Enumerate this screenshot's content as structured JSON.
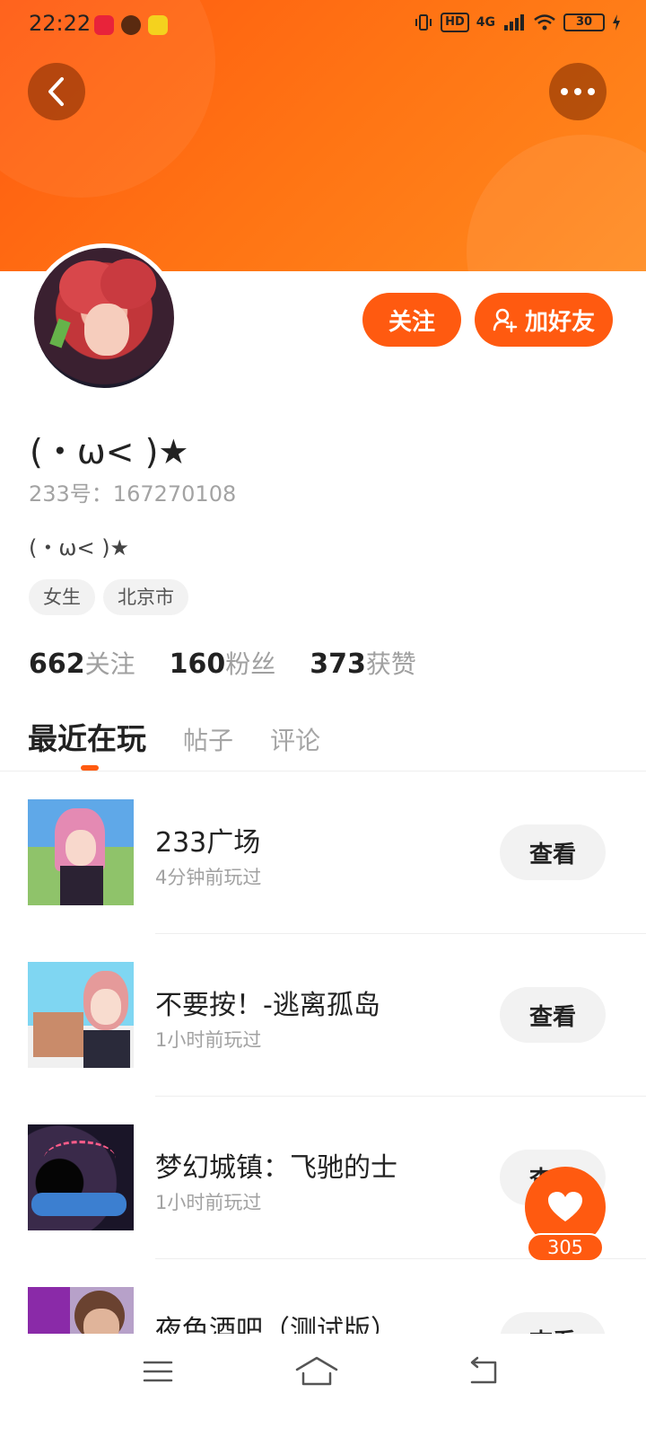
{
  "status_bar": {
    "time": "22:22",
    "hd_label": "HD",
    "network_label": "4G",
    "battery_level": "30"
  },
  "header": {
    "back_icon": "chevron-left-icon",
    "more_icon": "more-dots-icon",
    "accent_color": "#ff5a10"
  },
  "profile": {
    "nickname": "(・ω< )★",
    "user_id": "233号：167270108",
    "bio": "(・ω< )★",
    "tags": [
      "女生",
      "北京市"
    ],
    "follow_button": "关注",
    "add_friend_button": "加好友",
    "stats": [
      {
        "value": "662",
        "label": "关注"
      },
      {
        "value": "160",
        "label": "粉丝"
      },
      {
        "value": "373",
        "label": "获赞"
      }
    ]
  },
  "tabs": [
    {
      "label": "最近在玩",
      "active": true
    },
    {
      "label": "帖子",
      "active": false
    },
    {
      "label": "评论",
      "active": false
    }
  ],
  "games": [
    {
      "name": "233广场",
      "played": "4分钟前玩过",
      "button": "查看"
    },
    {
      "name": "不要按！-逃离孤岛",
      "played": "1小时前玩过",
      "button": "查看"
    },
    {
      "name": "梦幻城镇：飞驰的士",
      "played": "1小时前玩过",
      "button": "查看"
    },
    {
      "name": "夜色酒吧（测试版）",
      "played": "",
      "button": "查看"
    }
  ],
  "like_fab": {
    "count": "305",
    "icon": "heart-icon"
  },
  "nav_bar": {
    "icons": [
      "menu-icon",
      "home-icon",
      "back-icon"
    ]
  }
}
